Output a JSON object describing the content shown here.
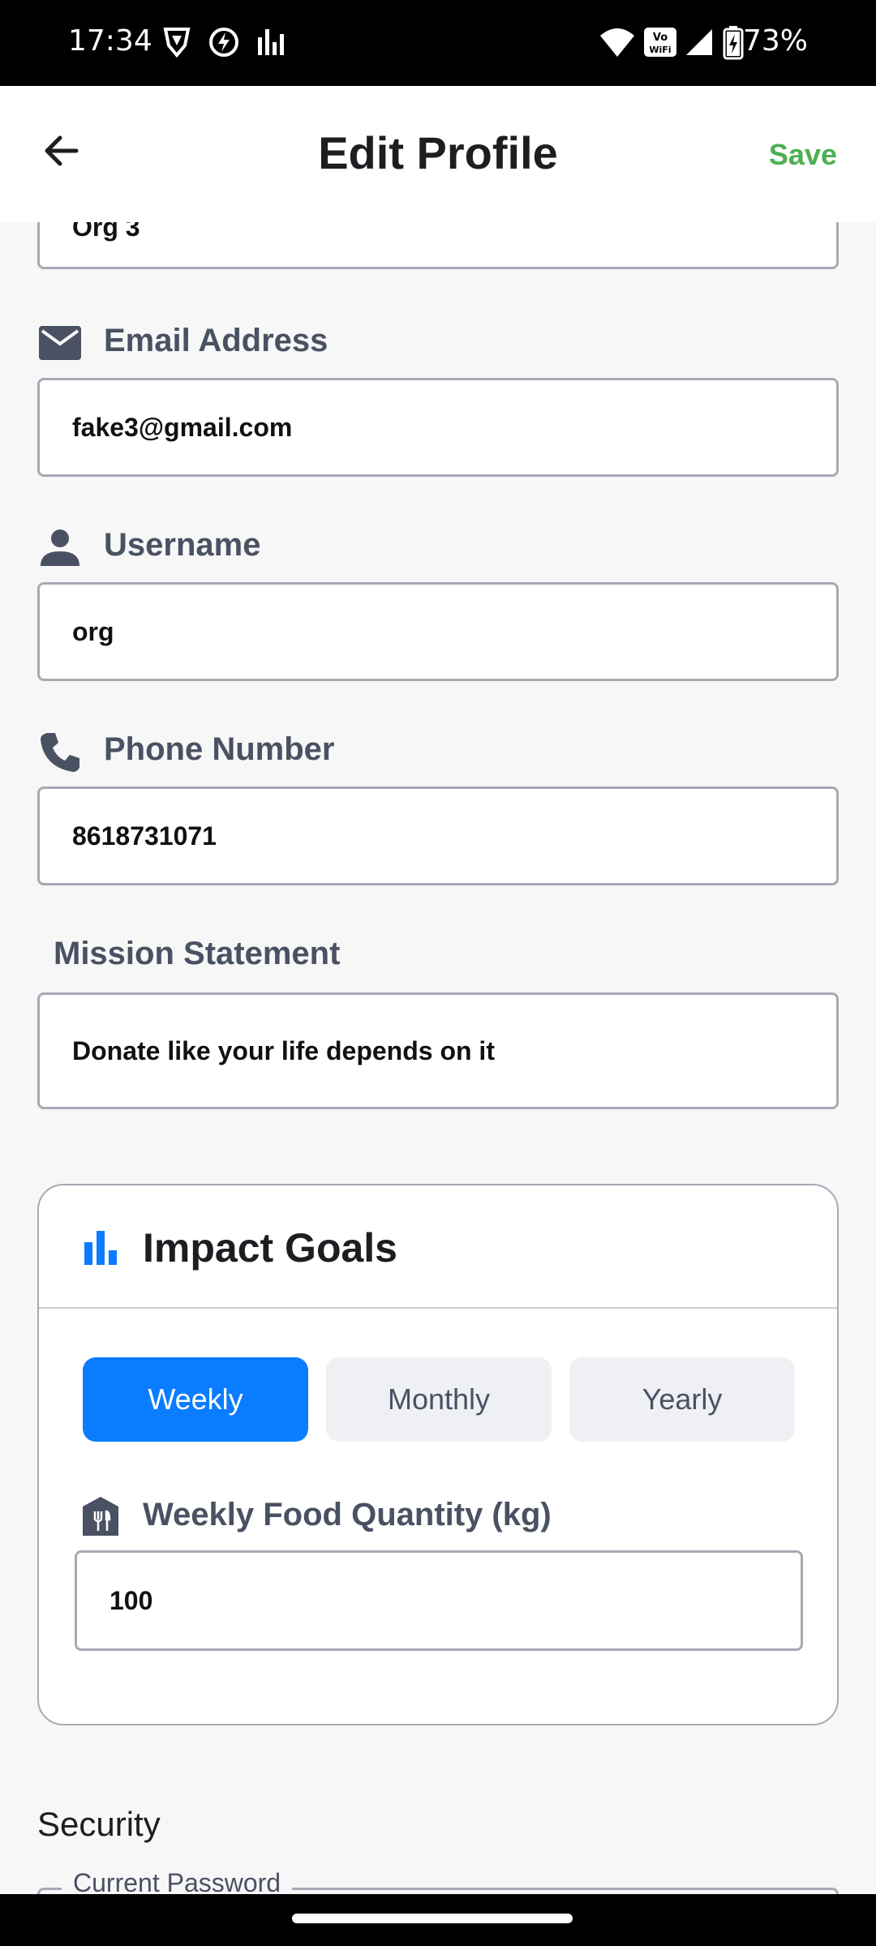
{
  "status_bar": {
    "time": "17:34",
    "battery": "73%"
  },
  "app_bar": {
    "title": "Edit Profile",
    "save_label": "Save"
  },
  "fields": {
    "org_name": {
      "value": "Org 3"
    },
    "email": {
      "label": "Email Address",
      "value": "fake3@gmail.com"
    },
    "username": {
      "label": "Username",
      "value": "org"
    },
    "phone": {
      "label": "Phone Number",
      "value": "8618731071"
    },
    "mission": {
      "label": "Mission Statement",
      "value": "Donate like your life depends on it"
    }
  },
  "impact_goals": {
    "title": "Impact Goals",
    "tabs": [
      {
        "label": "Weekly",
        "active": true
      },
      {
        "label": "Monthly",
        "active": false
      },
      {
        "label": "Yearly",
        "active": false
      }
    ],
    "food_label": "Weekly Food Quantity (kg)",
    "food_value": "100"
  },
  "security": {
    "heading": "Security",
    "current_password_label": "Current Password"
  },
  "colors": {
    "accent": "#0a7cff",
    "save": "#4caf50",
    "label": "#4a5162"
  }
}
